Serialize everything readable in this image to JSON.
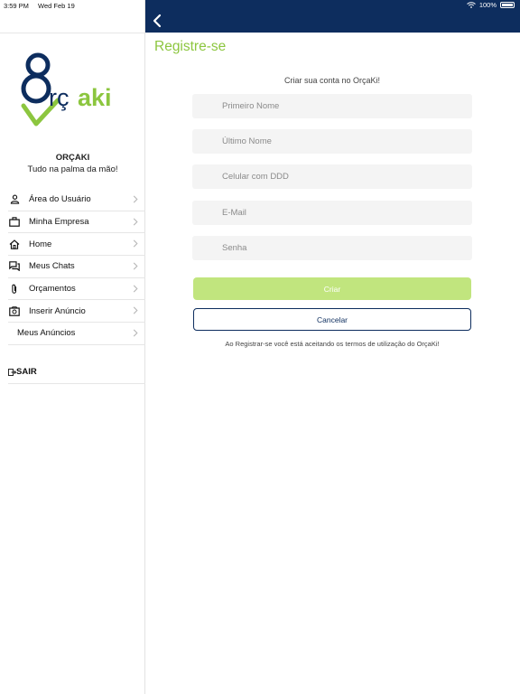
{
  "status": {
    "time": "3:59 PM",
    "date": "Wed Feb 19",
    "battery": "100%"
  },
  "sidebar": {
    "brand_name": "ORÇAKI",
    "tagline": "Tudo na palma da mão!",
    "logo_text": "orçaki",
    "items": [
      {
        "label": "Área do Usuário",
        "icon": "user-icon"
      },
      {
        "label": "Minha Empresa",
        "icon": "briefcase-icon"
      },
      {
        "label": "Home",
        "icon": "home-icon"
      },
      {
        "label": "Meus Chats",
        "icon": "chat-icon"
      },
      {
        "label": "Orçamentos",
        "icon": "paperclip-icon"
      },
      {
        "label": "Inserir Anúncio",
        "icon": "add-photo-icon"
      },
      {
        "label": "Meus Anúncios",
        "icon": ""
      }
    ],
    "logout_label": "SAIR"
  },
  "page": {
    "title": "Registre-se",
    "subtitle": "Criar sua conta no OrçaKi!",
    "fields": {
      "first_name": "Primeiro Nome",
      "last_name": "Último Nome",
      "phone": "Celular com DDD",
      "email": "E-Mail",
      "password": "Senha"
    },
    "create_label": "Criar",
    "cancel_label": "Cancelar",
    "terms": "Ao Registrar-se você está aceitando os termos de utilização do OrçaKi!"
  },
  "colors": {
    "navbar": "#0d2d5e",
    "accent_green": "#8cc63f",
    "button_green": "#c1e57e"
  }
}
